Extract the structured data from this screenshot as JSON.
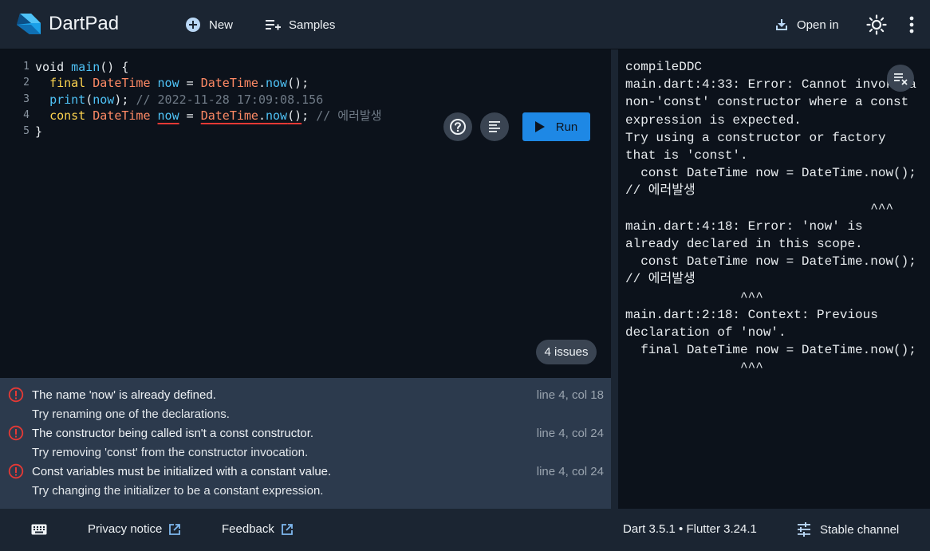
{
  "header": {
    "app_title": "DartPad",
    "new_label": "New",
    "samples_label": "Samples",
    "open_in_label": "Open in",
    "icons": {
      "logo": "dart-logo-icon",
      "new": "add-circle-icon",
      "samples": "playlist-add-icon",
      "open_in": "download-icon",
      "theme": "sun-icon",
      "more": "more-vert-icon"
    }
  },
  "editor": {
    "lines": [
      {
        "num": "1",
        "tokens": [
          {
            "t": "void ",
            "c": "kw"
          },
          {
            "t": "main",
            "c": "fn"
          },
          {
            "t": "() {",
            "c": "kw"
          }
        ]
      },
      {
        "num": "2",
        "tokens": [
          {
            "t": "  ",
            "c": "kw"
          },
          {
            "t": "final ",
            "c": "kw2"
          },
          {
            "t": "DateTime ",
            "c": "type"
          },
          {
            "t": "now",
            "c": "fn"
          },
          {
            "t": " = ",
            "c": "kw"
          },
          {
            "t": "DateTime",
            "c": "type"
          },
          {
            "t": ".",
            "c": "kw"
          },
          {
            "t": "now",
            "c": "fn"
          },
          {
            "t": "();",
            "c": "kw"
          }
        ]
      },
      {
        "num": "3",
        "tokens": [
          {
            "t": "  ",
            "c": "kw"
          },
          {
            "t": "print",
            "c": "fn"
          },
          {
            "t": "(",
            "c": "kw"
          },
          {
            "t": "now",
            "c": "fn"
          },
          {
            "t": "); ",
            "c": "kw"
          },
          {
            "t": "// 2022-11-28 17:09:08.156",
            "c": "cm"
          }
        ]
      },
      {
        "num": "4",
        "tokens": [
          {
            "t": "  ",
            "c": "kw"
          },
          {
            "t": "const ",
            "c": "kw2"
          },
          {
            "t": "DateTime ",
            "c": "type"
          },
          {
            "t": "now",
            "c": "fn err"
          },
          {
            "t": " = ",
            "c": "kw"
          },
          {
            "t": "DateTime",
            "c": "type err"
          },
          {
            "t": ".",
            "c": "kw err"
          },
          {
            "t": "now",
            "c": "fn err"
          },
          {
            "t": "()",
            "c": "kw err"
          },
          {
            "t": "; ",
            "c": "kw"
          },
          {
            "t": "// 에러발생",
            "c": "cm"
          }
        ]
      },
      {
        "num": "5",
        "tokens": [
          {
            "t": "}",
            "c": "kw"
          }
        ]
      }
    ],
    "run_label": "Run",
    "issues_count_label": "4 issues",
    "icons": {
      "help": "help-icon",
      "format": "format-align-icon",
      "run": "play-icon"
    }
  },
  "issues": [
    {
      "message": "The name 'now' is already defined.",
      "fix": "Try renaming one of the declarations.",
      "location": "line 4, col 18"
    },
    {
      "message": "The constructor being called isn't a const constructor.",
      "fix": "Try removing 'const' from the constructor invocation.",
      "location": "line 4, col 24"
    },
    {
      "message": "Const variables must be initialized with a constant value.",
      "fix": "Try changing the initializer to be a constant expression.",
      "location": "line 4, col 24"
    }
  ],
  "console": {
    "output": "compileDDC\nmain.dart:4:33: Error: Cannot invoke a\nnon-'const' constructor where a const\nexpression is expected.\nTry using a constructor or factory\nthat is 'const'.\n  const DateTime now = DateTime.now();\n// 에러발생\n                                ^^^\nmain.dart:4:18: Error: 'now' is\nalready declared in this scope.\n  const DateTime now = DateTime.now();\n// 에러발생\n               ^^^\nmain.dart:2:18: Context: Previous\ndeclaration of 'now'.\n  final DateTime now = DateTime.now();\n               ^^^",
    "icons": {
      "clear": "clear-all-icon"
    }
  },
  "footer": {
    "privacy_label": "Privacy notice",
    "feedback_label": "Feedback",
    "version_label": "Dart 3.5.1 • Flutter 3.24.1",
    "channel_label": "Stable channel",
    "icons": {
      "keyboard": "keyboard-icon",
      "external": "open-in-new-icon",
      "channel": "tune-icon"
    }
  },
  "colors": {
    "header_bg": "#1b2532",
    "editor_bg": "#0c121b",
    "issues_bg": "#2c3a4d",
    "run_button": "#1e88e5",
    "error_red": "#e53935"
  }
}
